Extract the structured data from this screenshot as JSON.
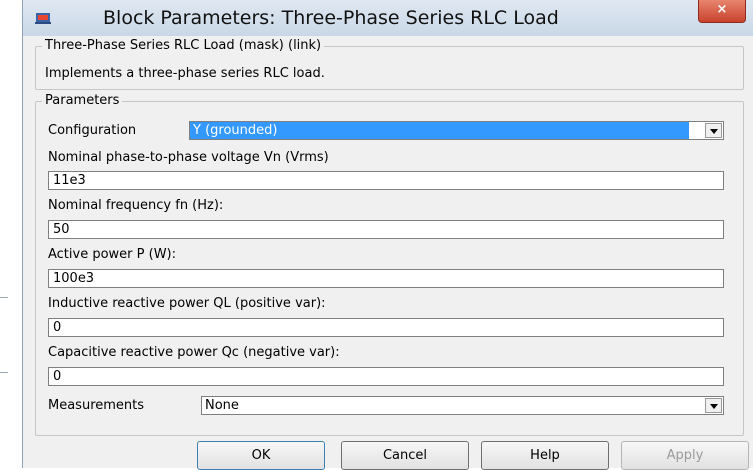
{
  "window": {
    "title": "Block Parameters: Three-Phase Series RLC Load",
    "close_label": "×"
  },
  "mask_group": {
    "title": "Three-Phase Series RLC Load (mask) (link)",
    "description": "Implements a three-phase series RLC load."
  },
  "params_group": {
    "title": "Parameters"
  },
  "fields": {
    "configuration": {
      "label": "Configuration",
      "value": "Y (grounded)"
    },
    "nominal_voltage": {
      "label": "Nominal phase-to-phase voltage Vn (Vrms)",
      "value": "11e3"
    },
    "nominal_frequency": {
      "label": "Nominal frequency fn (Hz):",
      "value": "50"
    },
    "active_power": {
      "label": "Active power P (W):",
      "value": "100e3"
    },
    "inductive_power": {
      "label": "Inductive reactive power QL (positive var):",
      "value": "0"
    },
    "capacitive_power": {
      "label": "Capacitive reactive power Qc (negative var):",
      "value": "0"
    },
    "measurements": {
      "label": "Measurements",
      "value": "None"
    }
  },
  "buttons": {
    "ok": "OK",
    "cancel": "Cancel",
    "help": "Help",
    "apply": "Apply"
  },
  "colors": {
    "selection": "#3399ff",
    "close_button": "#c9432c",
    "titlebar": "#c9d7e6"
  }
}
